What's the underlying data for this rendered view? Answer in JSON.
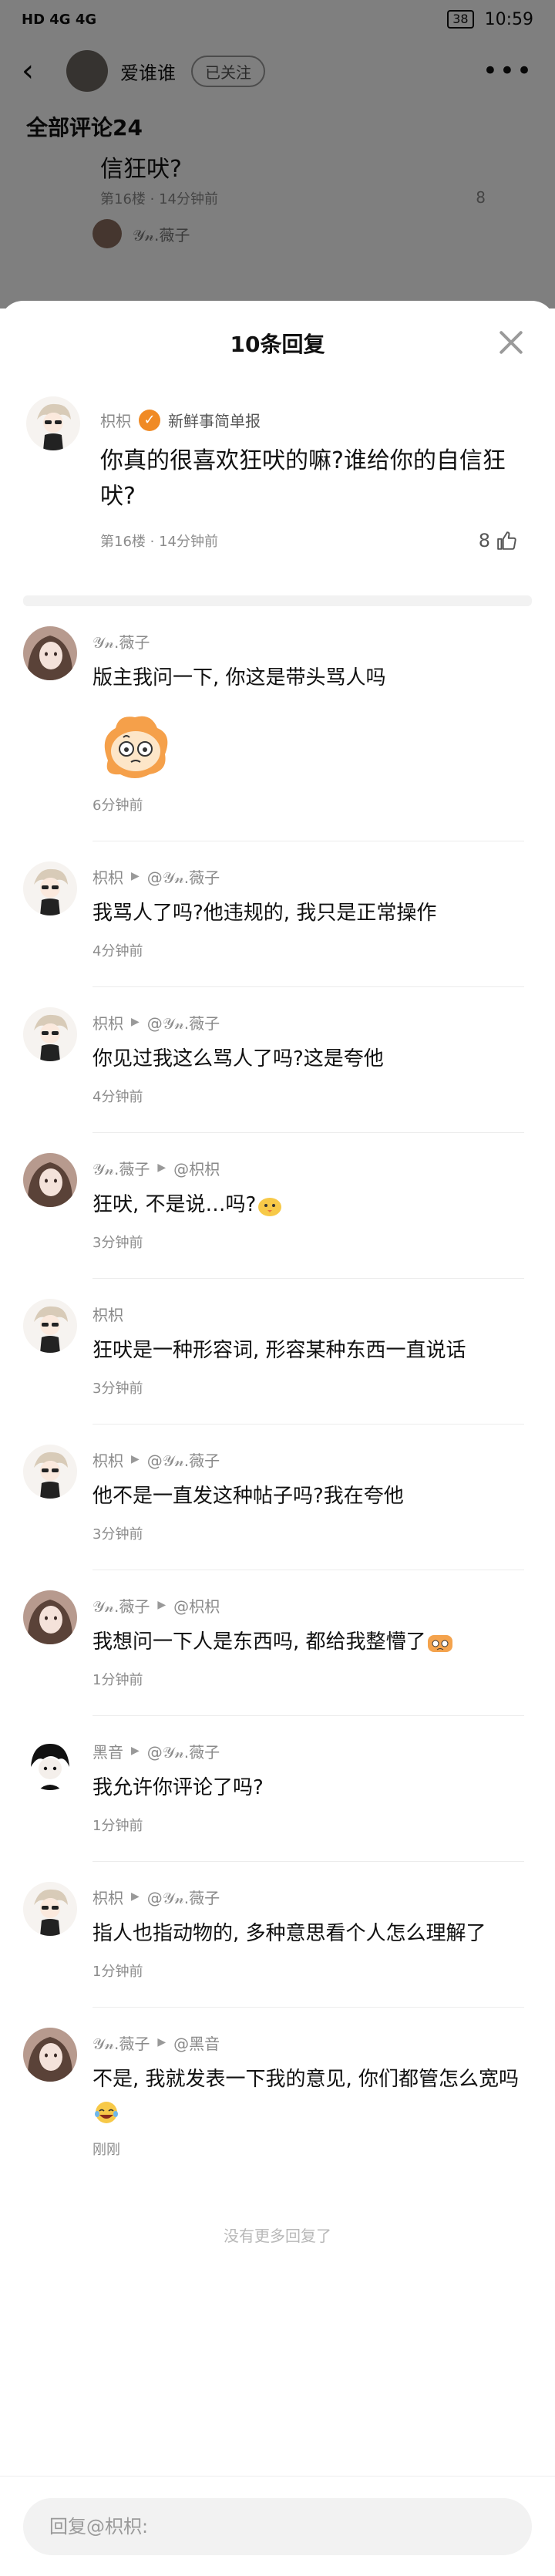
{
  "status": {
    "left": "HD 4G 4G",
    "battery": "38",
    "time": "10:59"
  },
  "topnav": {
    "name": "爱谁谁",
    "follow": "已关注"
  },
  "background": {
    "all_comments": "全部评论24",
    "cut_text": "信狂吠?",
    "cut_meta": "第16楼 · 14分钟前",
    "cut_likes": "8",
    "cut_sub_name": "𝒴𝓃.薇子"
  },
  "sheet": {
    "title": "10条回复",
    "main": {
      "author": "枳枳",
      "badge": "新鲜事简单报",
      "text": "你真的很喜欢狂吠的嘛?谁给你的自信狂吠?",
      "meta": "第16楼 · 14分钟前",
      "likes": "8"
    },
    "replies": [
      {
        "author": "𝒴𝓃.薇子",
        "to": "",
        "text": "版主我问一下, 你这是带头骂人吗",
        "time": "6分钟前",
        "avatar": "girl",
        "sticker": true
      },
      {
        "author": "枳枳",
        "to": "@𝒴𝓃.薇子",
        "text": "我骂人了吗?他违规的, 我只是正常操作",
        "time": "4分钟前",
        "avatar": "chibi"
      },
      {
        "author": "枳枳",
        "to": "@𝒴𝓃.薇子",
        "text": "你见过我这么骂人了吗?这是夸他",
        "time": "4分钟前",
        "avatar": "chibi"
      },
      {
        "author": "𝒴𝓃.薇子",
        "to": "@枳枳",
        "text": "狂吠, 不是说…吗?",
        "time": "3分钟前",
        "avatar": "girl",
        "emoji": "chick"
      },
      {
        "author": "枳枳",
        "to": "",
        "text": "狂吠是一种形容词, 形容某种东西一直说话",
        "time": "3分钟前",
        "avatar": "chibi"
      },
      {
        "author": "枳枳",
        "to": "@𝒴𝓃.薇子",
        "text": "他不是一直发这种帖子吗?我在夸他",
        "time": "3分钟前",
        "avatar": "chibi"
      },
      {
        "author": "𝒴𝓃.薇子",
        "to": "@枳枳",
        "text": "我想问一下人是东西吗, 都给我整懵了",
        "time": "1分钟前",
        "avatar": "girl",
        "emoji": "dazed"
      },
      {
        "author": "黑音",
        "to": "@𝒴𝓃.薇子",
        "text": "我允许你评论了吗?",
        "time": "1分钟前",
        "avatar": "dark"
      },
      {
        "author": "枳枳",
        "to": "@𝒴𝓃.薇子",
        "text": "指人也指动物的, 多种意思看个人怎么理解了",
        "time": "1分钟前",
        "avatar": "chibi"
      },
      {
        "author": "𝒴𝓃.薇子",
        "to": "@黑音",
        "text": "不是, 我就发表一下我的意见, 你们都管怎么宽吗",
        "time": "刚刚",
        "avatar": "girl",
        "emoji": "laugh"
      }
    ],
    "no_more": "没有更多回复了",
    "input_placeholder": "回复@枳枳:"
  },
  "colors": {
    "badge": "#f08a24",
    "overlay": "rgba(0,0,0,0.5)",
    "meta": "#8c8c8c"
  },
  "icons": [
    "back-icon",
    "more-icon",
    "close-icon",
    "thumb-up-icon",
    "verified-badge-icon",
    "arrow-right-icon"
  ]
}
